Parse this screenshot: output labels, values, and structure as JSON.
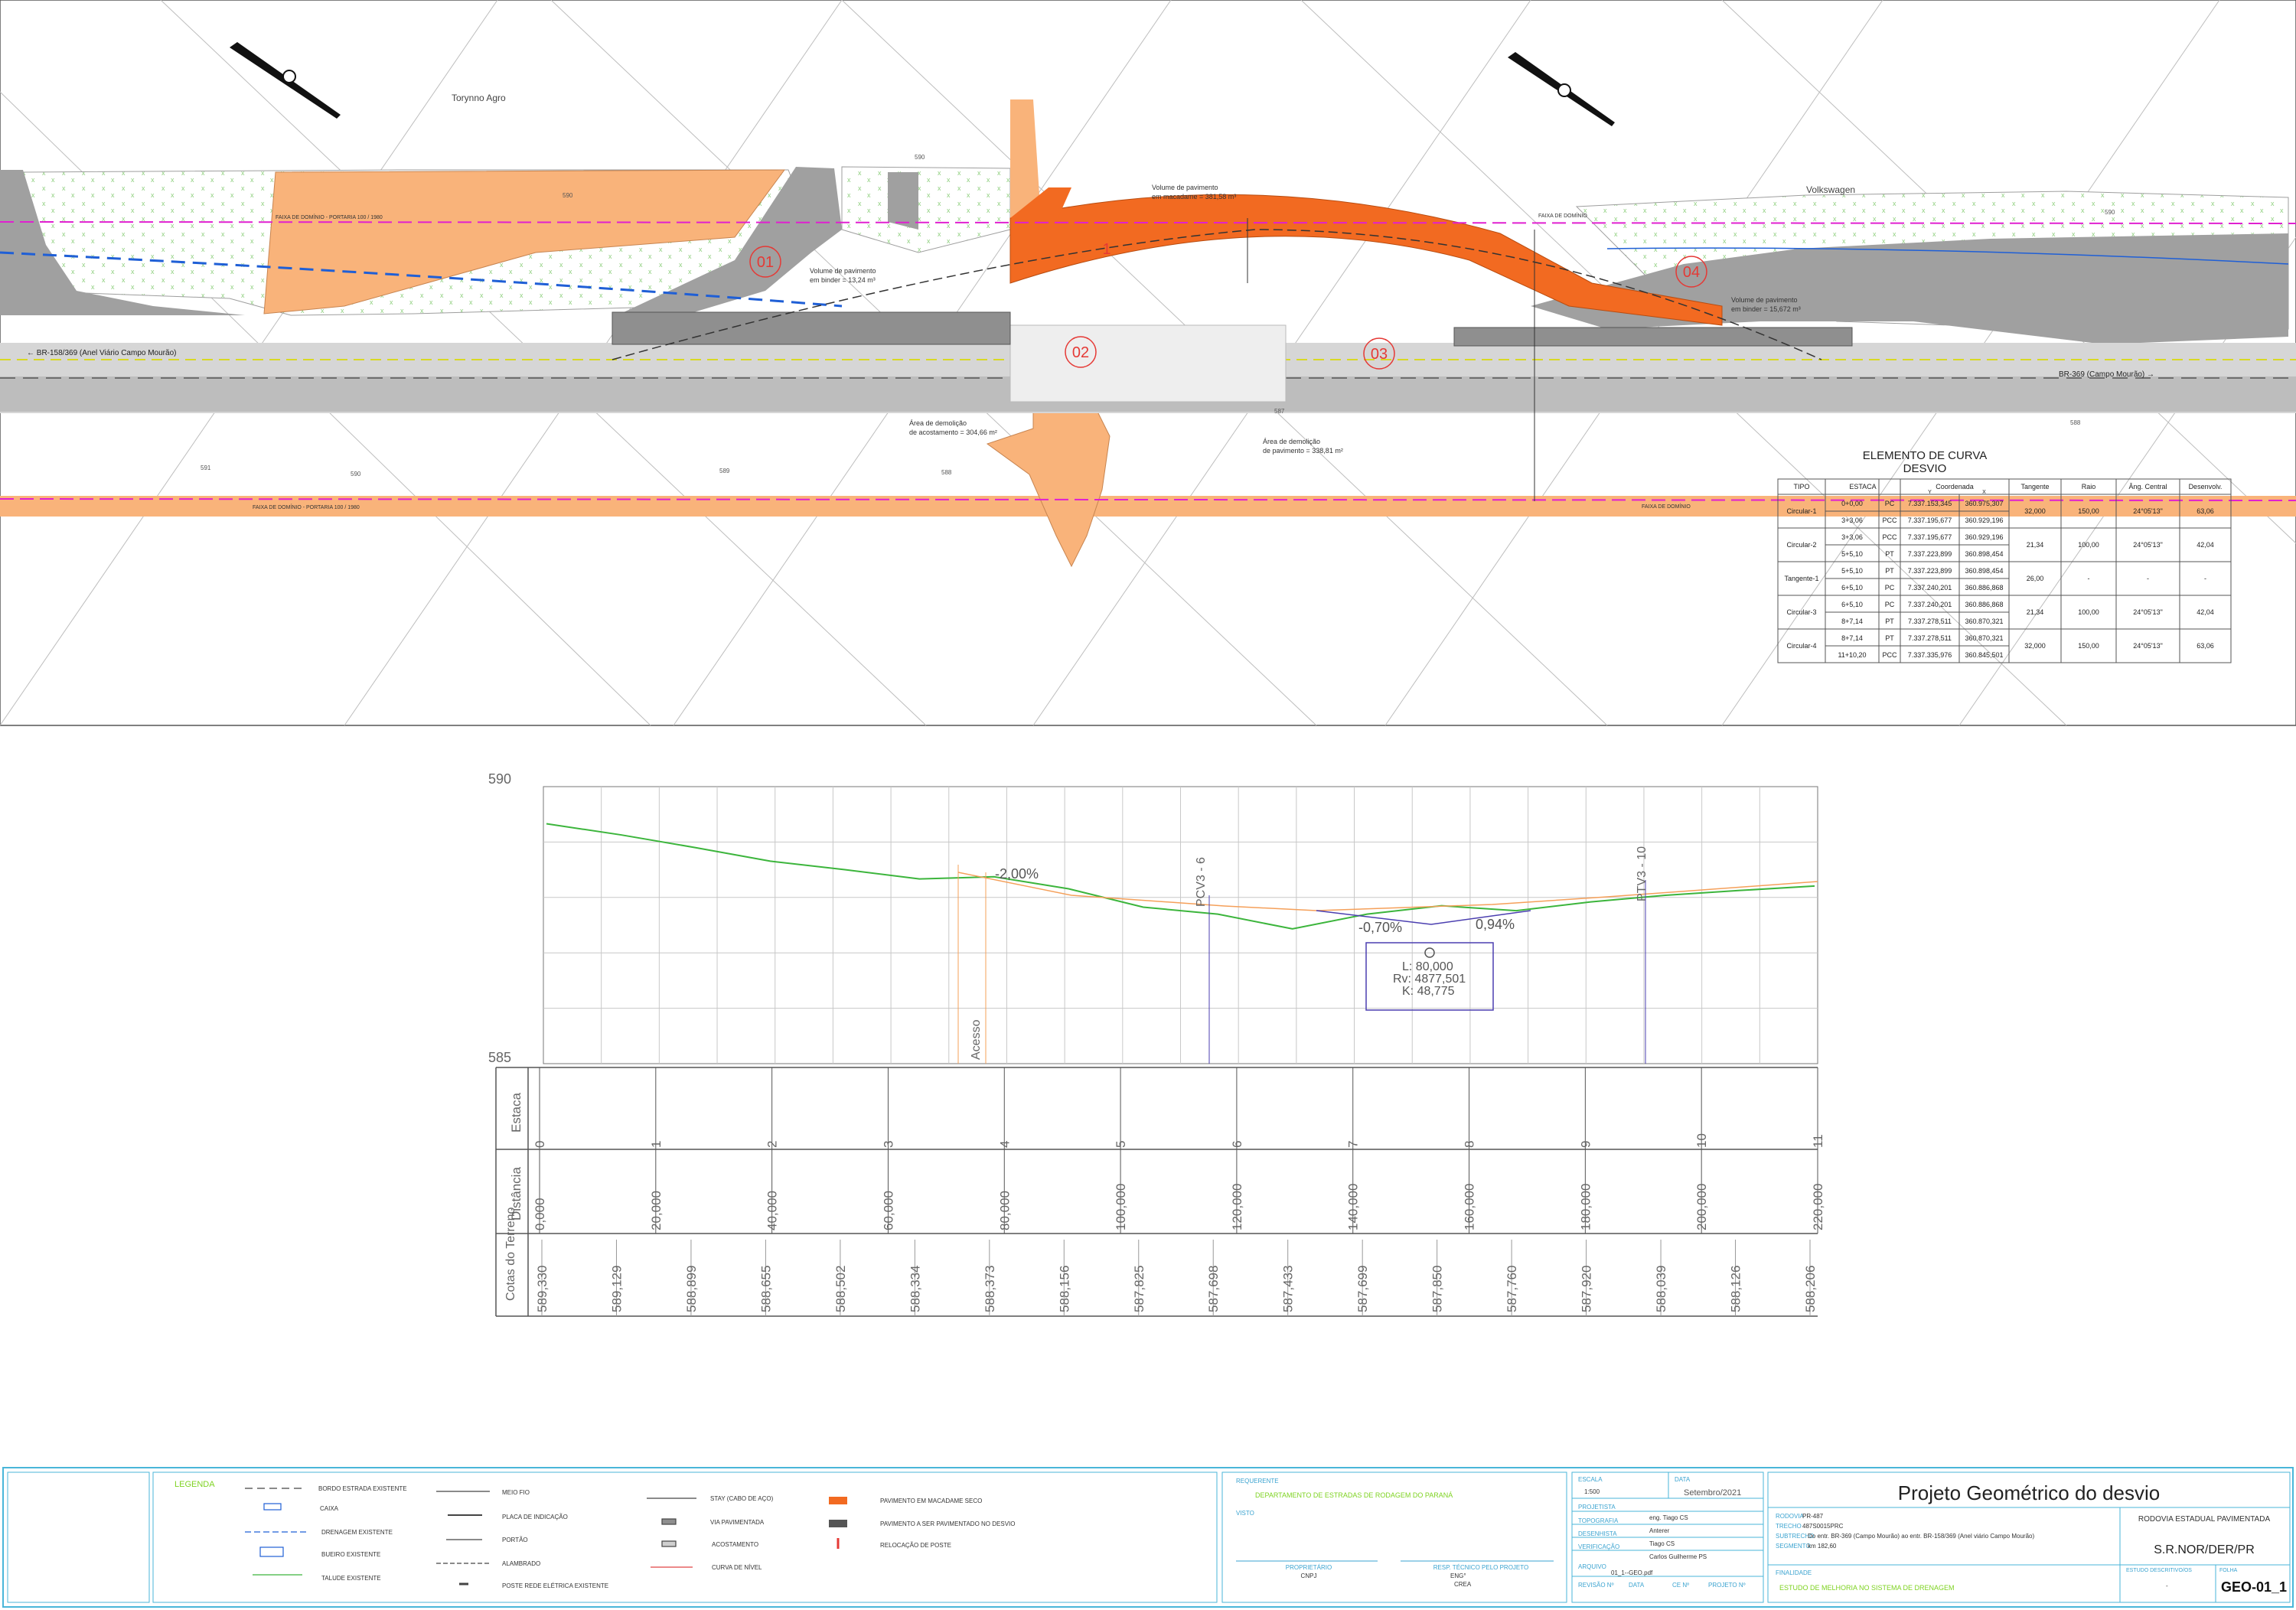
{
  "plan": {
    "owner_left": "Torynno Agro",
    "owner_right": "Volkswagen",
    "road_left": "← BR-158/369 (Anel Viário Campo Mourão)",
    "road_right": "BR-369 (Campo Mourão) →",
    "right_of_way": "FAIXA DE DOMÍNIO - PORTARIA 100 / 1980",
    "right_of_way_short": "FAIXA DE DOMÍNIO",
    "zones": [
      "01",
      "02",
      "03",
      "04"
    ],
    "center_mark": "1",
    "notes": {
      "macadame_line1": "Volume de pavimento",
      "macadame_line2": "em macadame = 381,58 m³",
      "binder_left_line1": "Volume de pavimento",
      "binder_left_line2": "em binder = 13,24 m³",
      "binder_right_line1": "Volume de pavimento",
      "binder_right_line2": "em binder = 15,672 m³",
      "shoulder_line1": "Área de demolição",
      "shoulder_line2": "de acostamento = 304,66 m²",
      "pavement_line1": "Área de demolição",
      "pavement_line2": "de pavimento = 338,81 m²"
    },
    "contours": [
      "590",
      "589",
      "588",
      "587",
      "586",
      "591"
    ]
  },
  "curve_table": {
    "title": "ELEMENTO DE CURVA",
    "subtitle": "DESVIO",
    "headers": [
      "TIPO",
      "ESTACA",
      "",
      "Coordenada",
      "",
      "Tangente",
      "Raio",
      "Âng. Central",
      "Desenvolv."
    ],
    "coord_sub": [
      "Y",
      "X"
    ],
    "groups": [
      {
        "tipo": "Circular-1",
        "tangente": "32,000",
        "raio": "150,00",
        "angulo": "24°05'13\"",
        "desenv": "63,06",
        "rows": [
          [
            "0+0,00",
            "PC",
            "7.337.153,345",
            "360.975,307"
          ],
          [
            "3+3,06",
            "PCC",
            "7.337.195,677",
            "360.929,196"
          ]
        ]
      },
      {
        "tipo": "Circular-2",
        "tangente": "21,34",
        "raio": "100,00",
        "angulo": "24°05'13\"",
        "desenv": "42,04",
        "rows": [
          [
            "3+3,06",
            "PCC",
            "7.337.195,677",
            "360.929,196"
          ],
          [
            "5+5,10",
            "PT",
            "7.337.223,899",
            "360.898,454"
          ]
        ]
      },
      {
        "tipo": "Tangente-1",
        "tangente": "26,00",
        "raio": "-",
        "angulo": "-",
        "desenv": "-",
        "rows": [
          [
            "5+5,10",
            "PT",
            "7.337.223,899",
            "360.898,454"
          ],
          [
            "6+5,10",
            "PC",
            "7.337.240,201",
            "360.886,868"
          ]
        ]
      },
      {
        "tipo": "Circular-3",
        "tangente": "21,34",
        "raio": "100,00",
        "angulo": "24°05'13\"",
        "desenv": "42,04",
        "rows": [
          [
            "6+5,10",
            "PC",
            "7.337.240,201",
            "360.886,868"
          ],
          [
            "8+7,14",
            "PT",
            "7.337.278,511",
            "360.870,321"
          ]
        ]
      },
      {
        "tipo": "Circular-4",
        "tangente": "32,000",
        "raio": "150,00",
        "angulo": "24°05'13\"",
        "desenv": "63,06",
        "rows": [
          [
            "8+7,14",
            "PT",
            "7.337.278,511",
            "360.870,321"
          ],
          [
            "11+10,20",
            "PCC",
            "7.337.335,976",
            "360.845,501"
          ]
        ]
      }
    ]
  },
  "profile": {
    "y_top": "590",
    "y_bottom": "585",
    "grade1": "-2,00%",
    "grade2": "-0,70%",
    "grade3": "0,94%",
    "pcv": "PCV3 - 6",
    "ptv": "PTV3 - 10",
    "access": "Acesso",
    "curve_L": "L:  80,000",
    "curve_Rv": "Rv:  4877,501",
    "curve_K": "K:  48,775",
    "row_labels": [
      "Estaca",
      "Distância",
      "Cotas do Terreno"
    ],
    "estacas": [
      "0",
      "1",
      "2",
      "3",
      "4",
      "5",
      "6",
      "7",
      "8",
      "9",
      "10",
      "11"
    ],
    "distancias": [
      "0,000",
      "20,000",
      "40,000",
      "60,000",
      "80,000",
      "100,000",
      "120,000",
      "140,000",
      "160,000",
      "180,000",
      "200,000",
      "220,000"
    ],
    "cotas": [
      "589,330",
      "589,129",
      "588,899",
      "588,655",
      "588,502",
      "588,334",
      "588,373",
      "588,156",
      "587,825",
      "587,698",
      "587,433",
      "587,699",
      "587,850",
      "587,760",
      "587,920",
      "588,039",
      "588,126",
      "588,206"
    ]
  },
  "legend": {
    "title": "LEGENDA",
    "col1": [
      "BORDO ESTRADA EXISTENTE",
      "CAIXA",
      "DRENAGEM EXISTENTE",
      "BUEIRO EXISTENTE",
      "TALUDE EXISTENTE"
    ],
    "col2": [
      "MEIO FIO",
      "PLACA DE INDICAÇÃO",
      "PORTÃO",
      "ALAMBRADO",
      "POSTE REDE ELÉTRICA EXISTENTE"
    ],
    "col3": [
      "STAY (CABO DE AÇO)",
      "VIA PAVIMENTADA",
      "ACOSTAMENTO",
      "CURVA DE NÍVEL"
    ],
    "col4": [
      "PAVIMENTO EM MACADAME  SECO",
      "PAVIMENTO A SER PAVIMENTADO NO DESVIO",
      "RELOCAÇÃO DE POSTE"
    ]
  },
  "titleblock": {
    "requerente_label": "REQUERENTE",
    "requerente": "DEPARTAMENTO DE ESTRADAS DE RODAGEM DO PARANÁ",
    "visto_label": "VISTO",
    "proprietario_label": "PROPRIETÁRIO",
    "proprietario": "CNPJ",
    "resp_label": "RESP. TÉCNICO PELO PROJETO",
    "resp_line1": "ENG°",
    "resp_line2": "CREA",
    "escala_label": "ESCALA",
    "escala": "1:500",
    "data_label": "DATA",
    "data": "Setembro/2021",
    "projetista_label": "PROJETISTA",
    "projetista": "eng. Tiago  CS",
    "topografia_label": "TOPOGRAFIA",
    "topografia": "Anterer",
    "desenhista_label": "DESENHISTA",
    "desenhista": "Tiago  CS",
    "verificacao_label": "VERIFICAÇÃO",
    "verificacao": "Carlos  Guilherme  PS",
    "arquivo_label": "ARQUIVO",
    "arquivo": "01_1--GEO.pdf",
    "revisao_label": "REVISÃO Nº",
    "data2_label": "DATA",
    "ce_label": "CE Nº",
    "projeto_n_label": "PROJETO Nº",
    "project_title": "Projeto Geométrico do desvio",
    "rodovia_label": "RODOVIA",
    "rodovia": "PR-487",
    "trecho_label": "TRECHO",
    "trecho": "487S0015PRC",
    "subtrecho_label": "SUBTRECHO",
    "subtrecho": "Do entr. BR-369 (Campo Mourão) ao entr. BR-158/369 (Anel viário Campo Mourão)",
    "segmento_label": "SEGMENTO",
    "segmento": "km 182,60",
    "rodovia_estadual": "RODOVIA ESTADUAL PAVIMENTADA",
    "org": "S.R.NOR/DER/PR",
    "finalidade_label": "FINALIDADE",
    "finalidade": "ESTUDO DE MELHORIA NO SISTEMA DE DRENAGEM",
    "descritivo_label": "ESTUDO DESCRITIVO/OS",
    "descritivo": "-",
    "folha_label": "FOLHA",
    "folha": "GEO-01_1"
  },
  "colors": {
    "macadame": "#f26a21",
    "gray_pavement": "#8f8f8f",
    "light_orange": "#f9b37a",
    "road_light": "#dcdcdc",
    "magenta": "#e020d0",
    "green": "#6ab04c"
  }
}
